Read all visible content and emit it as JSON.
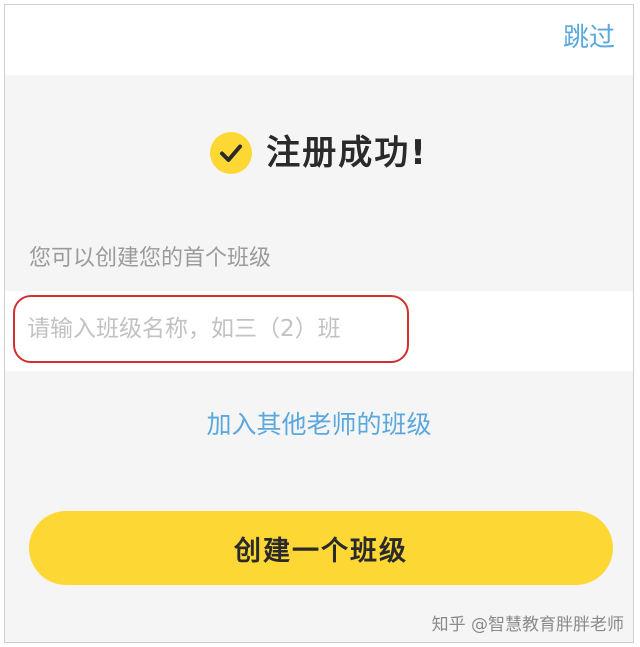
{
  "header": {
    "skip_label": "跳过"
  },
  "success": {
    "icon": "check-circle-icon",
    "title": "注册成功!"
  },
  "form": {
    "hint": "您可以创建您的首个班级",
    "class_name_value": "",
    "class_name_placeholder": "请输入班级名称，如三（2）班"
  },
  "actions": {
    "join_label": "加入其他老师的班级",
    "create_label": "创建一个班级"
  },
  "watermark": "知乎 @智慧教育胖胖老师",
  "colors": {
    "accent_yellow": "#fdd835",
    "link_blue": "#5aa8de",
    "highlight_red": "#d32f2f"
  }
}
